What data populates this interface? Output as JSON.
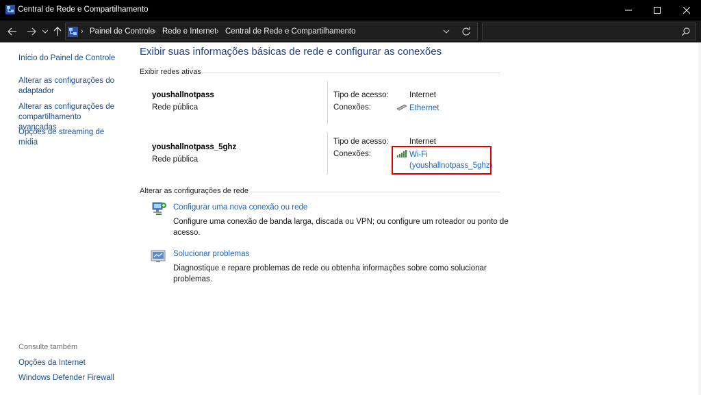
{
  "window": {
    "title": "Central de Rede e Compartilhamento"
  },
  "address": {
    "breadcrumbs": [
      "Painel de Controle",
      "Rede e Internet",
      "Central de Rede e Compartilhamento"
    ],
    "search_placeholder": ""
  },
  "sidebar": {
    "links": [
      "Início do Painel de Controle",
      "Alterar as configurações do adaptador",
      "Alterar as configurações de compartilhamento avançadas",
      "Opções de streaming de mídia"
    ],
    "see_also_caption": "Consulte também",
    "see_also_links": [
      "Opções da Internet",
      "Windows Defender Firewall"
    ]
  },
  "main": {
    "title": "Exibir suas informações básicas de rede e configurar as conexões",
    "active_networks_label": "Exibir redes ativas",
    "access_type_label": "Tipo de acesso:",
    "connections_label": "Conexões:",
    "networks": [
      {
        "name": "youshallnotpass",
        "profile": "Rede pública",
        "access_type": "Internet",
        "connection": "Ethernet",
        "connection_icon": "ethernet-icon"
      },
      {
        "name": "youshallnotpass_5ghz",
        "profile": "Rede pública",
        "access_type": "Internet",
        "connection": "Wi-Fi",
        "connection_detail": "(youshallnotpass_5ghz)",
        "connection_icon": "wifi-signal-icon"
      }
    ],
    "change_settings_label": "Alterar as configurações de rede",
    "tasks": [
      {
        "title": "Configurar uma nova conexão ou rede",
        "description": "Configure uma conexão de banda larga, discada ou VPN; ou configure um roteador ou ponto de acesso.",
        "icon": "new-connection-icon"
      },
      {
        "title": "Solucionar problemas",
        "description": "Diagnostique e repare problemas de rede ou obtenha informações sobre como solucionar problemas.",
        "icon": "troubleshoot-icon"
      }
    ]
  },
  "colors": {
    "link": "#1a66b8",
    "title": "#1e3f8c",
    "highlight": "#e00000",
    "titlebar": "#000000"
  }
}
